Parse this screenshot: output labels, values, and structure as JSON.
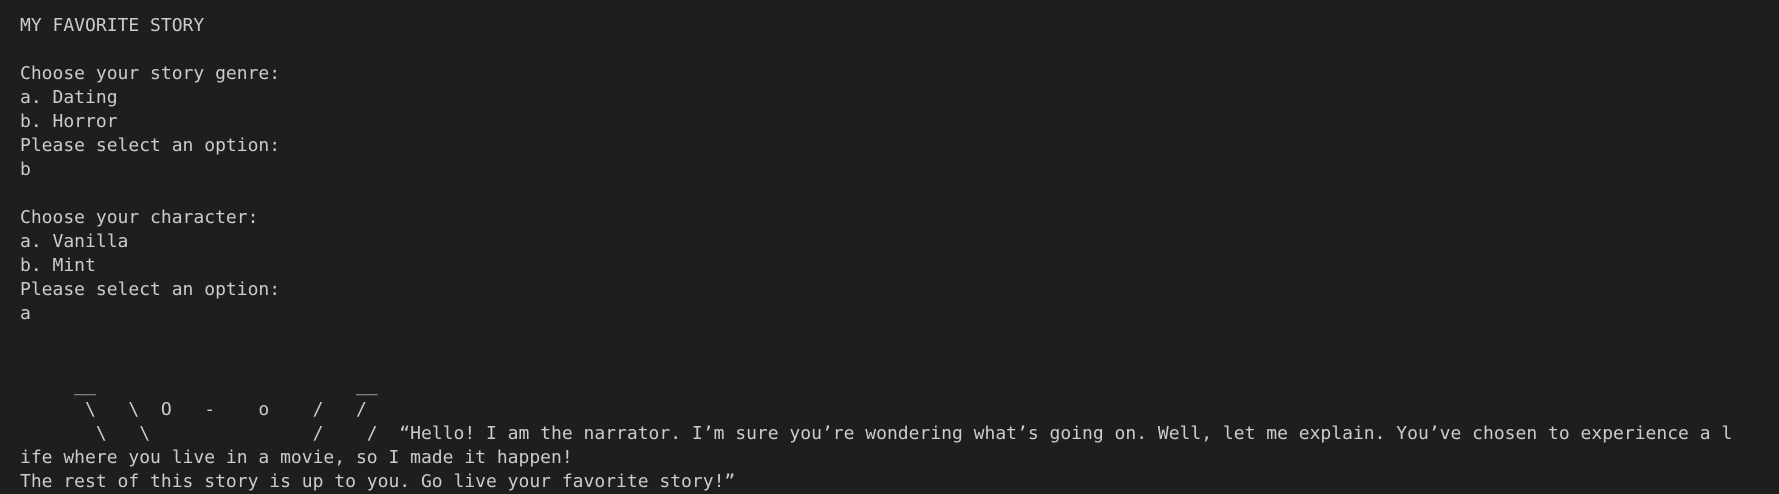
{
  "terminal": {
    "title": "MY FAVORITE STORY",
    "genre": {
      "prompt": "Choose your story genre:",
      "option_a": "a. Dating",
      "option_b": "b. Horror",
      "select_prompt": "Please select an option:",
      "input": "b"
    },
    "character": {
      "prompt": "Choose your character:",
      "option_a": "a. Vanilla",
      "option_b": "b. Mint",
      "select_prompt": "Please select an option:",
      "input": "a"
    },
    "art": {
      "line1": "     __                        __",
      "line2": "      \\   \\  O   -    o    /   /",
      "line3": "       \\   \\               /    /  “Hello! I am the narrator. I’m sure you’re wondering what’s going on. Well, let me explain. You’ve chosen to experience a l"
    },
    "narration": {
      "line1": "ife where you live in a movie, so I made it happen!",
      "line2": "The rest of this story is up to you. Go live your favorite story!”"
    },
    "colors": {
      "background": "#1e1e1e",
      "text": "#cccccc"
    }
  }
}
